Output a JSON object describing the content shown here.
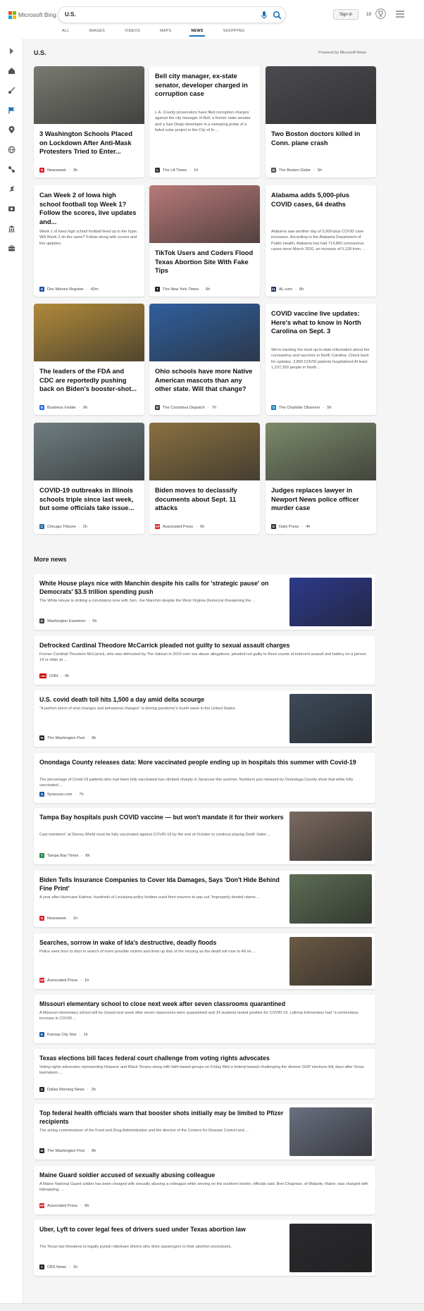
{
  "header": {
    "logo_text": "Microsoft Bing",
    "query": "U.S.",
    "signin_label": "Sign in",
    "rewards_count": "10",
    "scopes": [
      "ALL",
      "IMAGES",
      "VIDEOS",
      "MAPS",
      "NEWS",
      "SHOPPING"
    ],
    "active_scope": "NEWS"
  },
  "sidebar": {
    "icons": [
      "expand-icon",
      "home-icon",
      "sports-icon",
      "flag-icon",
      "location-icon",
      "world-icon",
      "science-icon",
      "technology-icon",
      "entertainment-icon",
      "politics-icon",
      "business-icon"
    ]
  },
  "main": {
    "section_title": "U.S.",
    "powered_by": "Powered by Microsoft News",
    "more_news_title": "More news",
    "cards": [
      {
        "headline": "3 Washington Schools Placed on Lockdown After Anti-Mask Protesters Tried to Enter...",
        "snippet": "",
        "source": "Newsweek",
        "time": "3h",
        "logo": "N",
        "logo_color": "#e31b23",
        "thumb_color": "#7a7a72"
      },
      {
        "headline": "Bell city manager, ex-state senator, developer charged in corruption case",
        "snippet": "L.A. County prosecutors have filed corruption charges against the city manager of Bell, a former state senator and a San Diego developer in a sweeping probe of a failed solar project in the City of In ...",
        "source": "The LA Times",
        "time": "1h",
        "logo": "L",
        "logo_color": "#333333",
        "thumb_color": ""
      },
      {
        "headline": "Two Boston doctors killed in Conn. plane crash",
        "snippet": "",
        "source": "The Boston Globe",
        "time": "5h",
        "logo": "B",
        "logo_color": "#555555",
        "thumb_color": "#4a4a50"
      },
      {
        "headline": "Can Week 2 of Iowa high school football top Week 1? Follow the scores, live updates and...",
        "snippet": "Week 1 of Iowa high school football lived up to the hype. Will Week 2 do the same? Follow along with scores and live updates.",
        "source": "Des Moines Register",
        "time": "42m",
        "logo": "D",
        "logo_color": "#1f4e9c",
        "thumb_color": ""
      },
      {
        "headline": "TikTok Users and Coders Flood Texas Abortion Site With Fake Tips",
        "snippet": "",
        "source": "The New York Times",
        "time": "6h",
        "logo": "T",
        "logo_color": "#222222",
        "thumb_color": "#b87a78"
      },
      {
        "headline": "Alabama adds 5,000-plus COVID cases, 64 deaths",
        "snippet": "Alabama saw another day of 5,000-plus COVID case increases. According to the Alabama Department of Public Health, Alabama has had 714,860 coronavirus cases since March 2020, an increase of 5,128 from ...",
        "source": "AL.com",
        "time": "6h",
        "logo": "AL",
        "logo_color": "#223355",
        "thumb_color": ""
      },
      {
        "headline": "The leaders of the FDA and CDC are reportedly pushing back on Biden's booster-shot...",
        "snippet": "",
        "source": "Business Insider",
        "time": "9h",
        "logo": "B",
        "logo_color": "#2a6ce0",
        "thumb_color": "#b08a3a"
      },
      {
        "headline": "Ohio schools have more Native American mascots than any other state. Will that change?",
        "snippet": "",
        "source": "The Columbus Dispatch",
        "time": "7h",
        "logo": "D",
        "logo_color": "#444444",
        "thumb_color": "#2f5f9e"
      },
      {
        "headline": "COVID vaccine live updates: Here's what to know in North Carolina on Sept. 3",
        "snippet": "We're tracking the most up-to-date information about the coronavirus and vaccines in North Carolina. Check back for updates. 3,800 COVID patients hospitalized At least 1,237,393 people in North ...",
        "source": "The Charlotte Observer",
        "time": "5h",
        "logo": "O",
        "logo_color": "#1b7fc4",
        "thumb_color": ""
      },
      {
        "headline": "COVID-19 outbreaks in Illinois schools triple since last week, but some officials take issue...",
        "snippet": "",
        "source": "Chicago Tribune",
        "time": "2h",
        "logo": "C",
        "logo_color": "#2a6a9c",
        "thumb_color": "#6f7d80"
      },
      {
        "headline": "Biden moves to declassify documents about Sept. 11 attacks",
        "snippet": "",
        "source": "Associated Press",
        "time": "6h",
        "logo": "AP",
        "logo_color": "#d8232a",
        "thumb_color": "#8a7040"
      },
      {
        "headline": "Judges replaces lawyer in Newport News police officer murder case",
        "snippet": "",
        "source": "Daily Press",
        "time": "4h",
        "logo": "D",
        "logo_color": "#333333",
        "thumb_color": "#7d8a6a"
      }
    ],
    "more_news": [
      {
        "title": "White House plays nice with Manchin despite his calls for 'strategic pause' on Democrats' $3.5 trillion spending push",
        "snippet": "The White House is striking a conciliatory tone with Sen. Joe Manchin despite the West Virginia Democrat threatening the ...",
        "source": "Washington Examiner",
        "time": "5h",
        "logo": "E",
        "logo_color": "#444444",
        "thumb_color": "#2d3a8c"
      },
      {
        "title": "Defrocked Cardinal Theodore McCarrick pleaded not guilty to sexual assault charges",
        "snippet": "Former Cardinal Theodore McCarrick, who was defrocked by The Vatican in 2019 over sex abuse allegations, pleaded not guilty to three counts of indecent assault and battery on a person 14 or older at ...",
        "source": "CNN",
        "time": "9h",
        "logo": "CNN",
        "logo_color": "#cc0000",
        "thumb_color": ""
      },
      {
        "title": "U.S. covid death toll hits 1,500 a day amid delta scourge",
        "snippet": "\"A perfect storm of viral changes and behavioral changes\" is driving pandemic's fourth wave in the United States.",
        "source": "The Washington Post",
        "time": "9h",
        "logo": "W",
        "logo_color": "#222222",
        "thumb_color": "#3e4a5a"
      },
      {
        "title": "Onondaga County releases data: More vaccinated people ending up in hospitals this summer with Covid-19",
        "snippet": "The percentage of Covid-19 patients who had been fully vaccinated has climbed sharply in Syracuse this summer. Numbers just released by Onondaga County show that while fully vaccinated ...",
        "source": "Syracuse.com",
        "time": "7h",
        "logo": "S",
        "logo_color": "#1b5fa8",
        "thumb_color": ""
      },
      {
        "title": "Tampa Bay hospitals push COVID vaccine — but won't mandate it for their workers",
        "snippet": "Cast members\" at Disney World must be fully vaccinated against COVID-19 by the end of October to continue playing Darth Vader ...",
        "source": "Tampa Bay Times",
        "time": "8h",
        "logo": "T",
        "logo_color": "#2b8a4a",
        "thumb_color": "#7a6a60"
      },
      {
        "title": "Biden Tells Insurance Companies to Cover Ida Damages, Says 'Don't Hide Behind Fine Print'",
        "snippet": "A year after Hurricane Katrina, hundreds of Louisiana policy holders sued their insurers to pay out \"improperly denied claims ...",
        "source": "Newsweek",
        "time": "1h",
        "logo": "N",
        "logo_color": "#e31b23",
        "thumb_color": "#5e6e55"
      },
      {
        "title": "Searches, sorrow in wake of Ida's destructive, deadly floods",
        "snippet": "Police went door to door in search of more possible victims and drew up lists of the missing as the death toll rose to 49 on ...",
        "source": "Associated Press",
        "time": "1h",
        "logo": "AP",
        "logo_color": "#d8232a",
        "thumb_color": "#6b5a45"
      },
      {
        "title": "Missouri elementary school to close next week after seven classrooms quarantined",
        "snippet": "A Missouri elementary school will be closed next week after seven classrooms were quarantined and 14 students tested positive for COVID-19. Lathrop Elementary had \"a tremendous increase in COVID ...",
        "source": "Kansas City Star",
        "time": "1h",
        "logo": "K",
        "logo_color": "#1f5fa6",
        "thumb_color": ""
      },
      {
        "title": "Texas elections bill faces federal court challenge from voting rights advocates",
        "snippet": "Voting rights advocates representing Hispanic and Black Texans along with faith-based groups on Friday filed a federal lawsuit challenging the divisive GOP elections bill, days after Texas lawmakers ...",
        "source": "Dallas Morning News",
        "time": "2h",
        "logo": "D",
        "logo_color": "#222222",
        "thumb_color": ""
      },
      {
        "title": "Top federal health officials warn that booster shots initially may be limited to Pfizer recipients",
        "snippet": "The acting commissioner of the Food and Drug Administration and the director of the Centers for Disease Control and ...",
        "source": "The Washington Post",
        "time": "8h",
        "logo": "W",
        "logo_color": "#222222",
        "thumb_color": "#6a7080"
      },
      {
        "title": "Maine Guard soldier accused of sexually abusing colleague",
        "snippet": "A Maine National Guard soldier has been charged with sexually abusing a colleague while serving on the southern border, officials said. Bret Chapman, of Walpole, Maine, was charged with kidnapping, ...",
        "source": "Associated Press",
        "time": "9h",
        "logo": "AP",
        "logo_color": "#d8232a",
        "thumb_color": ""
      },
      {
        "title": "Uber, Lyft to cover legal fees of drivers sued under Texas abortion law",
        "snippet": "The Texas law threatens to legally punish rideshare drivers who drive passengers to their abortion procedures.",
        "source": "CBS News",
        "time": "1h",
        "logo": "C",
        "logo_color": "#222222",
        "thumb_color": "#2a2a2e"
      }
    ]
  },
  "colors": {
    "accent": "#1a73b8",
    "logo_red": "#f25022",
    "logo_green": "#7fba00",
    "logo_blue": "#00a4ef",
    "logo_yellow": "#ffb900"
  }
}
